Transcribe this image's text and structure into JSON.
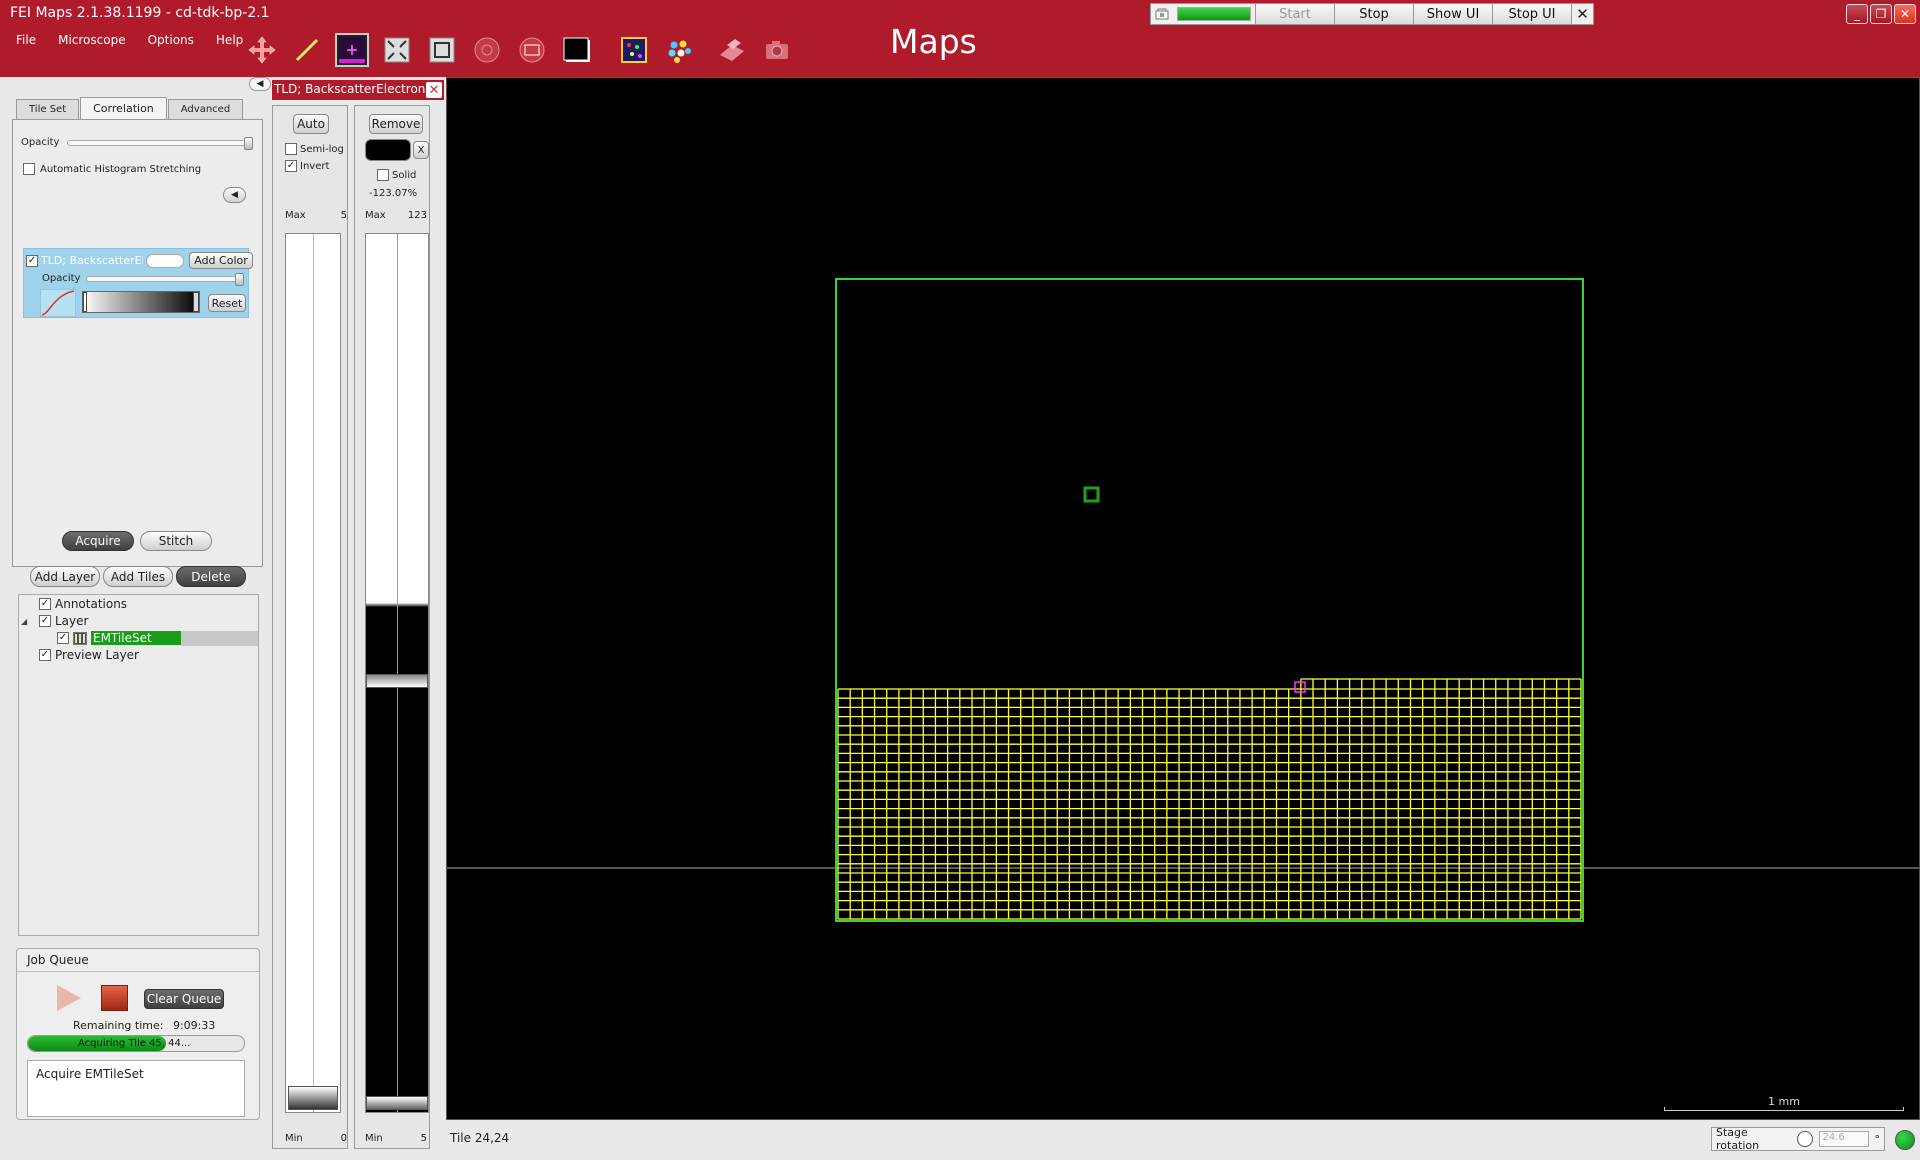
{
  "window": {
    "title": "FEI Maps 2.1.38.1199 - cd-tdk-bp-2.1",
    "brand": "Maps",
    "controls": [
      "_",
      "❐",
      "✕"
    ]
  },
  "menu": [
    "File",
    "Microscope",
    "Options",
    "Help"
  ],
  "toolbar_icons": [
    "move-icon",
    "measure-icon",
    "crosshair-icon",
    "fit-all-icon",
    "fit-selection-icon",
    "target-icon",
    "region-icon",
    "snapshot-icon",
    "color-mix-icon",
    "dots-icon",
    "stage-icon",
    "camera-icon"
  ],
  "acquisition_controls": {
    "progress": 1.0,
    "buttons": [
      {
        "label": "Start",
        "enabled": false
      },
      {
        "label": "Stop",
        "enabled": true
      },
      {
        "label": "Show UI",
        "enabled": true
      },
      {
        "label": "Stop UI",
        "enabled": true
      }
    ],
    "close_label": "✕"
  },
  "left_panel": {
    "tabs": [
      {
        "label": "Tile Set",
        "active": false
      },
      {
        "label": "Correlation",
        "active": true
      },
      {
        "label": "Advanced",
        "active": false
      }
    ],
    "opacity_label": "Opacity",
    "auto_histogram_label": "Automatic Histogram Stretching",
    "auto_histogram_checked": false,
    "channel": {
      "name": "TLD; BackscatterEle",
      "checked": true,
      "add_color_label": "Add Color",
      "opacity_label": "Opacity",
      "reset_label": "Reset"
    },
    "acquire_label": "Acquire",
    "stitch_label": "Stitch",
    "add_layer_label": "Add Layer",
    "add_tiles_label": "Add Tiles",
    "delete_label": "Delete",
    "layers": [
      {
        "label": "Annotations",
        "checked": true,
        "level": 0
      },
      {
        "label": "Layer",
        "checked": true,
        "level": 0,
        "expanded": true
      },
      {
        "label": "EMTileSet",
        "checked": true,
        "level": 1,
        "selected": true
      },
      {
        "label": "Preview Layer",
        "checked": true,
        "level": 0
      }
    ],
    "job_queue": {
      "title": "Job Queue",
      "clear_label": "Clear Queue",
      "remaining_label": "Remaining time:",
      "remaining_value": "9:09:33",
      "progress_text": "Acquiring Tile 45, 44...",
      "progress": 0.64,
      "log": "Acquire EMTileSet"
    }
  },
  "histogram_panel": {
    "title": "TLD; BackscatterElectrons",
    "auto_label": "Auto",
    "semilog_label": "Semi-log",
    "semilog_checked": false,
    "invert_label": "Invert",
    "invert_checked": true,
    "remove_label": "Remove",
    "color_x": "X",
    "solid_label": "Solid",
    "solid_checked": false,
    "percent": "-123.07%",
    "col1": {
      "max_label": "Max",
      "max_value": "5",
      "min_label": "Min",
      "min_value": "0"
    },
    "col2": {
      "max_label": "Max",
      "max_value": "123",
      "min_label": "Min",
      "min_value": "5"
    }
  },
  "canvas": {
    "scale_label": "1 mm",
    "colors": {
      "frame": "#35d535",
      "grid": "#ffff33",
      "marker": "#ff33ff"
    },
    "tile_grid": {
      "columns": 61,
      "rows": 25
    }
  },
  "statusbar": {
    "tile": "Tile 24,24",
    "stage_rotation_label": "Stage rotation",
    "stage_rotation_value": "24.6",
    "unit": "°"
  }
}
